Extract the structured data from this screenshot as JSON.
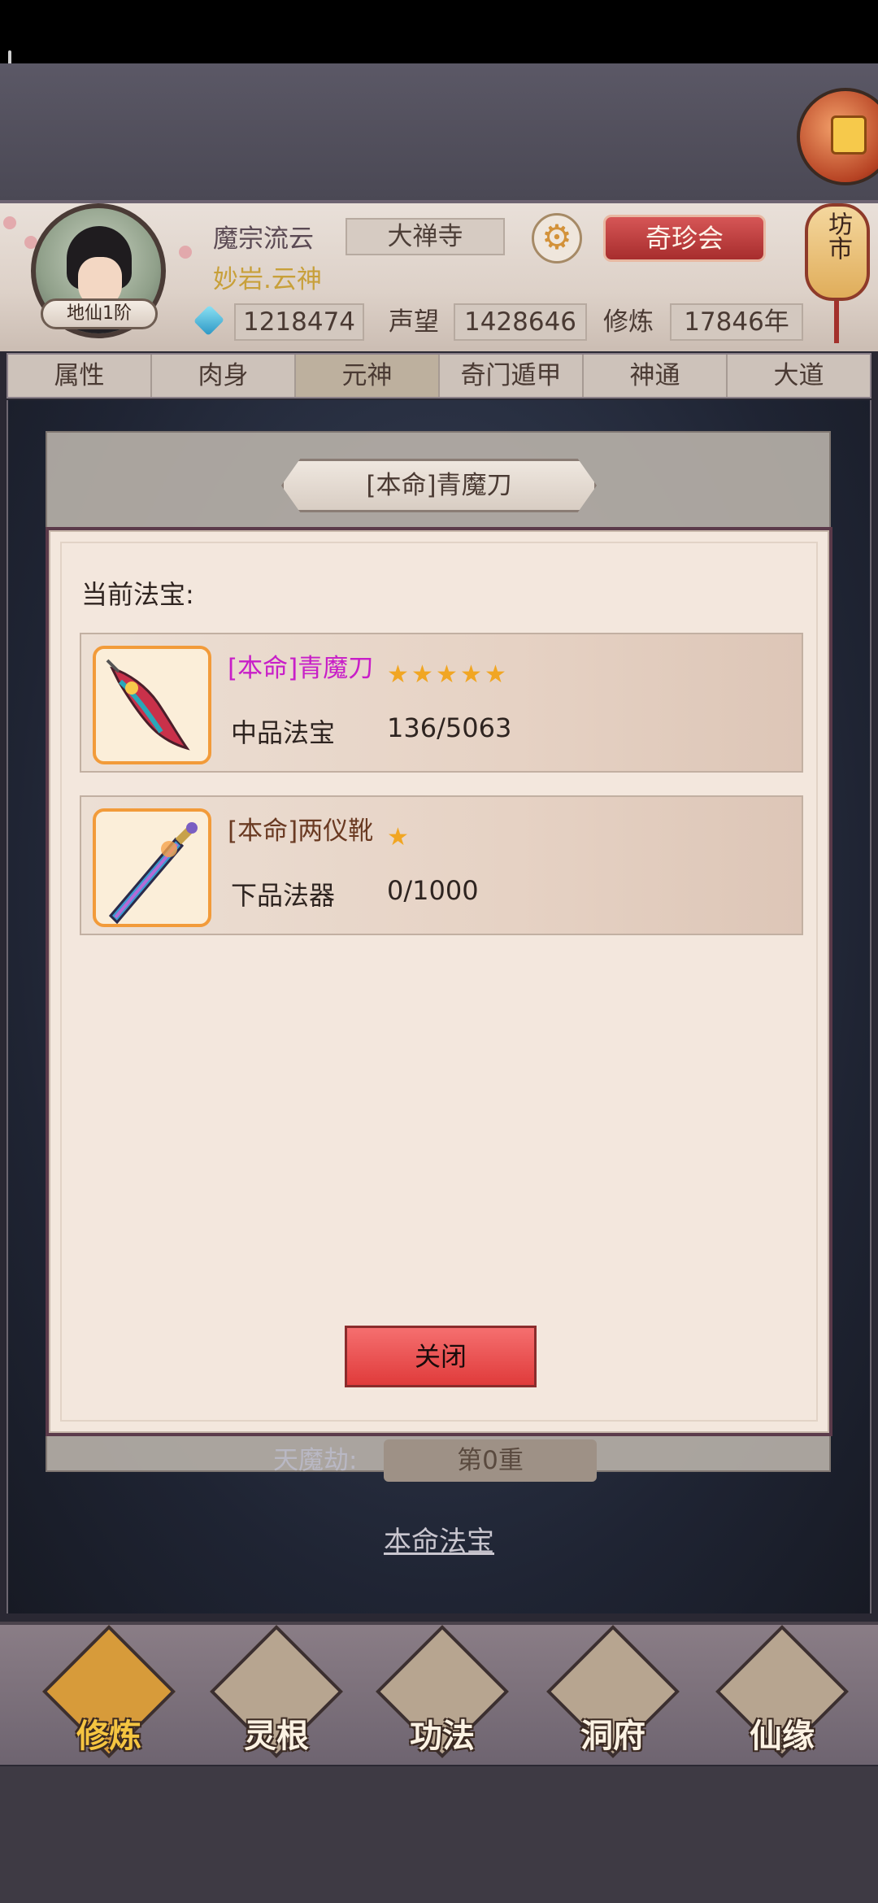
{
  "header": {
    "player_name": "魔宗流云",
    "player_title": "妙岩.云神",
    "sect": "大禅寺",
    "rank": "地仙1阶",
    "treasure_button": "奇珍会",
    "market_lantern": "坊市",
    "stats": {
      "spirit_stones": "1218474",
      "reputation_label": "声望",
      "reputation": "1428646",
      "cultivation_label": "修炼",
      "cultivation": "17846年"
    }
  },
  "tabs": [
    "属性",
    "肉身",
    "元神",
    "奇门遁甲",
    "神通",
    "大道"
  ],
  "active_tab": "元神",
  "background": {
    "heavenly_tribulation_label": "天魔劫:",
    "heavenly_tribulation_value": "第0重",
    "bound_treasure_link": "本命法宝"
  },
  "modal": {
    "title": "[本命]青魔刀",
    "current_label": "当前法宝:",
    "items": [
      {
        "name": "[本命]青魔刀",
        "name_color": "#c81ec8",
        "stars": 5,
        "grade": "中品法宝",
        "progress": "136/5063"
      },
      {
        "name": "[本命]两仪靴",
        "name_color": "#6a3a22",
        "stars": 1,
        "grade": "下品法器",
        "progress": "0/1000"
      }
    ],
    "close_label": "关闭"
  },
  "bottom_nav": [
    "修炼",
    "灵根",
    "功法",
    "洞府",
    "仙缘"
  ],
  "active_nav": "修炼",
  "colors": {
    "accent_red": "#e03b3b",
    "star_gold": "#f1a623",
    "item_border": "#f29b3a"
  },
  "icons": [
    "gear-icon",
    "gem-icon",
    "star-icon",
    "blade-icon",
    "sword-icon"
  ]
}
